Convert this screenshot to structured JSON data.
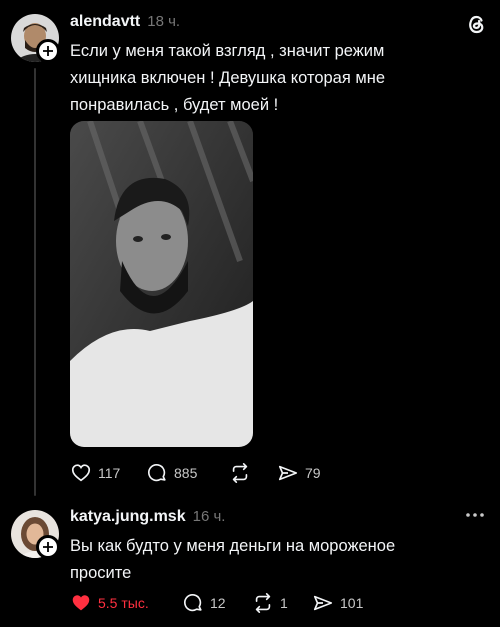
{
  "post": {
    "username": "alendavtt",
    "time": "18 ч.",
    "text_lines": [
      "Если у меня такой взгляд , значит режим",
      "хищника включен ! Девушка которая мне",
      "понравилась , будет моей !"
    ],
    "stats": {
      "likes": "117",
      "comments": "885",
      "reposts": "",
      "shares": "79"
    }
  },
  "reply": {
    "username": "katya.jung.msk",
    "time": "16 ч.",
    "text_lines": [
      "Вы как будто у меня деньги на мороженое",
      "просите"
    ],
    "stats": {
      "likes": "5.5 тыс.",
      "comments": "12",
      "reposts": "1",
      "shares": "101"
    }
  },
  "colors": {
    "liked": "#ff3040",
    "muted": "#777777",
    "background": "#000000"
  },
  "icons": {
    "app": "threads-icon",
    "like": "heart-icon",
    "comment": "comment-icon",
    "repost": "repost-icon",
    "share": "share-icon",
    "more": "more-icon"
  }
}
